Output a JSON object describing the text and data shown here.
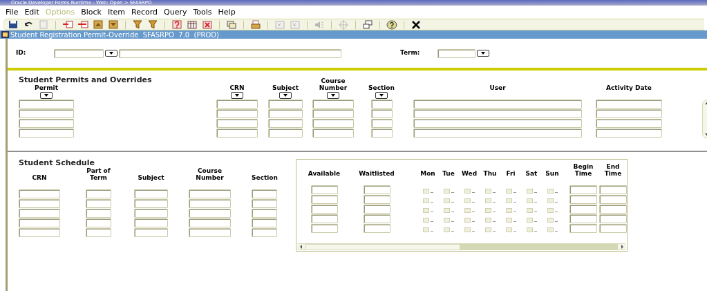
{
  "window": {
    "title": "Oracle Developer Forms Runtime - Web: Open > SFASRPO"
  },
  "menu": [
    {
      "label": "File",
      "disabled": false
    },
    {
      "label": "Edit",
      "disabled": false
    },
    {
      "label": "Options",
      "disabled": true
    },
    {
      "label": "Block",
      "disabled": false
    },
    {
      "label": "Item",
      "disabled": false
    },
    {
      "label": "Record",
      "disabled": false
    },
    {
      "label": "Query",
      "disabled": false
    },
    {
      "label": "Tools",
      "disabled": false
    },
    {
      "label": "Help",
      "disabled": false
    }
  ],
  "toolbar": [
    {
      "kind": "floppy",
      "disabled": false
    },
    {
      "kind": "undo",
      "disabled": false
    },
    {
      "kind": "page",
      "disabled": true
    },
    {
      "kind": "separator"
    },
    {
      "kind": "arrow-in",
      "disabled": false
    },
    {
      "kind": "arrow-out",
      "disabled": false
    },
    {
      "kind": "tray-up",
      "disabled": false
    },
    {
      "kind": "tray-down",
      "disabled": false
    },
    {
      "kind": "separator"
    },
    {
      "kind": "funnel",
      "disabled": false
    },
    {
      "kind": "funnel",
      "disabled": false
    },
    {
      "kind": "separator"
    },
    {
      "kind": "question-box",
      "disabled": false
    },
    {
      "kind": "grid",
      "disabled": false
    },
    {
      "kind": "x-box",
      "disabled": false
    },
    {
      "kind": "separator"
    },
    {
      "kind": "stack",
      "disabled": false
    },
    {
      "kind": "separator"
    },
    {
      "kind": "printer",
      "disabled": false
    },
    {
      "kind": "separator"
    },
    {
      "kind": "field",
      "disabled": true
    },
    {
      "kind": "field",
      "disabled": true
    },
    {
      "kind": "separator"
    },
    {
      "kind": "speaker",
      "disabled": true
    },
    {
      "kind": "separator"
    },
    {
      "kind": "target",
      "disabled": true
    },
    {
      "kind": "separator"
    },
    {
      "kind": "windows",
      "disabled": false
    },
    {
      "kind": "separator"
    },
    {
      "kind": "help",
      "disabled": false
    },
    {
      "kind": "separator"
    },
    {
      "kind": "exit",
      "disabled": false
    }
  ],
  "form": {
    "title": "Student Registration Permit-Override  SFASRPO  7.0  (PROD)"
  },
  "key_block": {
    "id_label": "ID:",
    "term_label": "Term:"
  },
  "permits": {
    "title": "Student Permits and Overrides",
    "columns": [
      {
        "label": "Permit",
        "lov": true
      },
      {
        "label": "CRN",
        "lov": true
      },
      {
        "label": "Subject",
        "lov": true
      },
      {
        "label": "Course\nNumber",
        "lov": true
      },
      {
        "label": "Section",
        "lov": true
      },
      {
        "label": "User",
        "lov": false
      },
      {
        "label": "Activity Date",
        "lov": false
      }
    ]
  },
  "schedule": {
    "title": "Student Schedule",
    "columns": [
      "CRN",
      "Part of\nTerm",
      "Subject",
      "Course\nNumber",
      "Section"
    ],
    "panel_columns": [
      "Available",
      "Waitlisted"
    ],
    "days": [
      "Mon",
      "Tue",
      "Wed",
      "Thu",
      "Fri",
      "Sat",
      "Sun"
    ],
    "time_columns": [
      "Begin\nTime",
      "End\nTime"
    ],
    "rows": [
      {
        "days": [
          {
            "checked": false
          },
          {
            "checked": false
          },
          {
            "checked": false
          },
          {
            "checked": false
          },
          {
            "checked": false
          },
          {
            "checked": false
          },
          {
            "checked": false
          }
        ]
      },
      {
        "days": [
          {
            "checked": false
          },
          {
            "checked": false
          },
          {
            "checked": false
          },
          {
            "checked": false
          },
          {
            "checked": false
          },
          {
            "checked": false
          },
          {
            "checked": false
          }
        ]
      },
      {
        "days": [
          {
            "checked": false
          },
          {
            "checked": false
          },
          {
            "checked": false
          },
          {
            "checked": false
          },
          {
            "checked": false
          },
          {
            "checked": false
          },
          {
            "checked": false
          }
        ]
      },
      {
        "days": [
          {
            "checked": false
          },
          {
            "checked": false
          },
          {
            "checked": false
          },
          {
            "checked": false
          },
          {
            "checked": false
          },
          {
            "checked": false
          },
          {
            "checked": false
          }
        ]
      },
      {
        "days": [
          {
            "checked": false
          },
          {
            "checked": false
          },
          {
            "checked": false
          },
          {
            "checked": false
          },
          {
            "checked": false
          },
          {
            "checked": false
          },
          {
            "checked": false
          }
        ]
      }
    ]
  }
}
